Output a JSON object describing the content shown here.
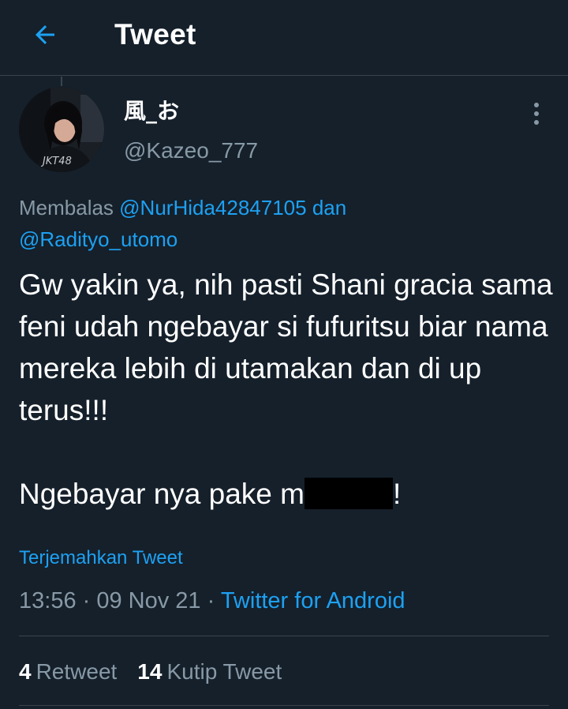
{
  "header": {
    "title": "Tweet",
    "back_icon": "arrow-left-icon"
  },
  "author": {
    "display_name": "風_お",
    "handle": "@Kazeo_777",
    "avatar_text": "JKT48"
  },
  "replying": {
    "prefix": "Membalas ",
    "mention1": "@NurHida42847105",
    "conjunction": " dan",
    "mention2": "@Radityo_utomo"
  },
  "tweet": {
    "text_para1": "Gw yakin ya, nih pasti Shani gracia sama feni udah ngebayar si fufuritsu biar nama mereka lebih di utamakan dan di up terus!!!",
    "text_para2_before": "Ngebayar nya pake m",
    "text_para2_after": "!",
    "translate_label": "Terjemahkan Tweet",
    "time": "13:56",
    "date": "09 Nov 21",
    "separator": " · ",
    "source": "Twitter for Android"
  },
  "stats": {
    "retweets_count": "4",
    "retweets_label": "Retweet",
    "quotes_count": "14",
    "quotes_label": "Kutip Tweet"
  },
  "colors": {
    "background": "#15202b",
    "accent": "#1da1f2",
    "secondary_text": "#8899a6",
    "border": "#38444d"
  }
}
